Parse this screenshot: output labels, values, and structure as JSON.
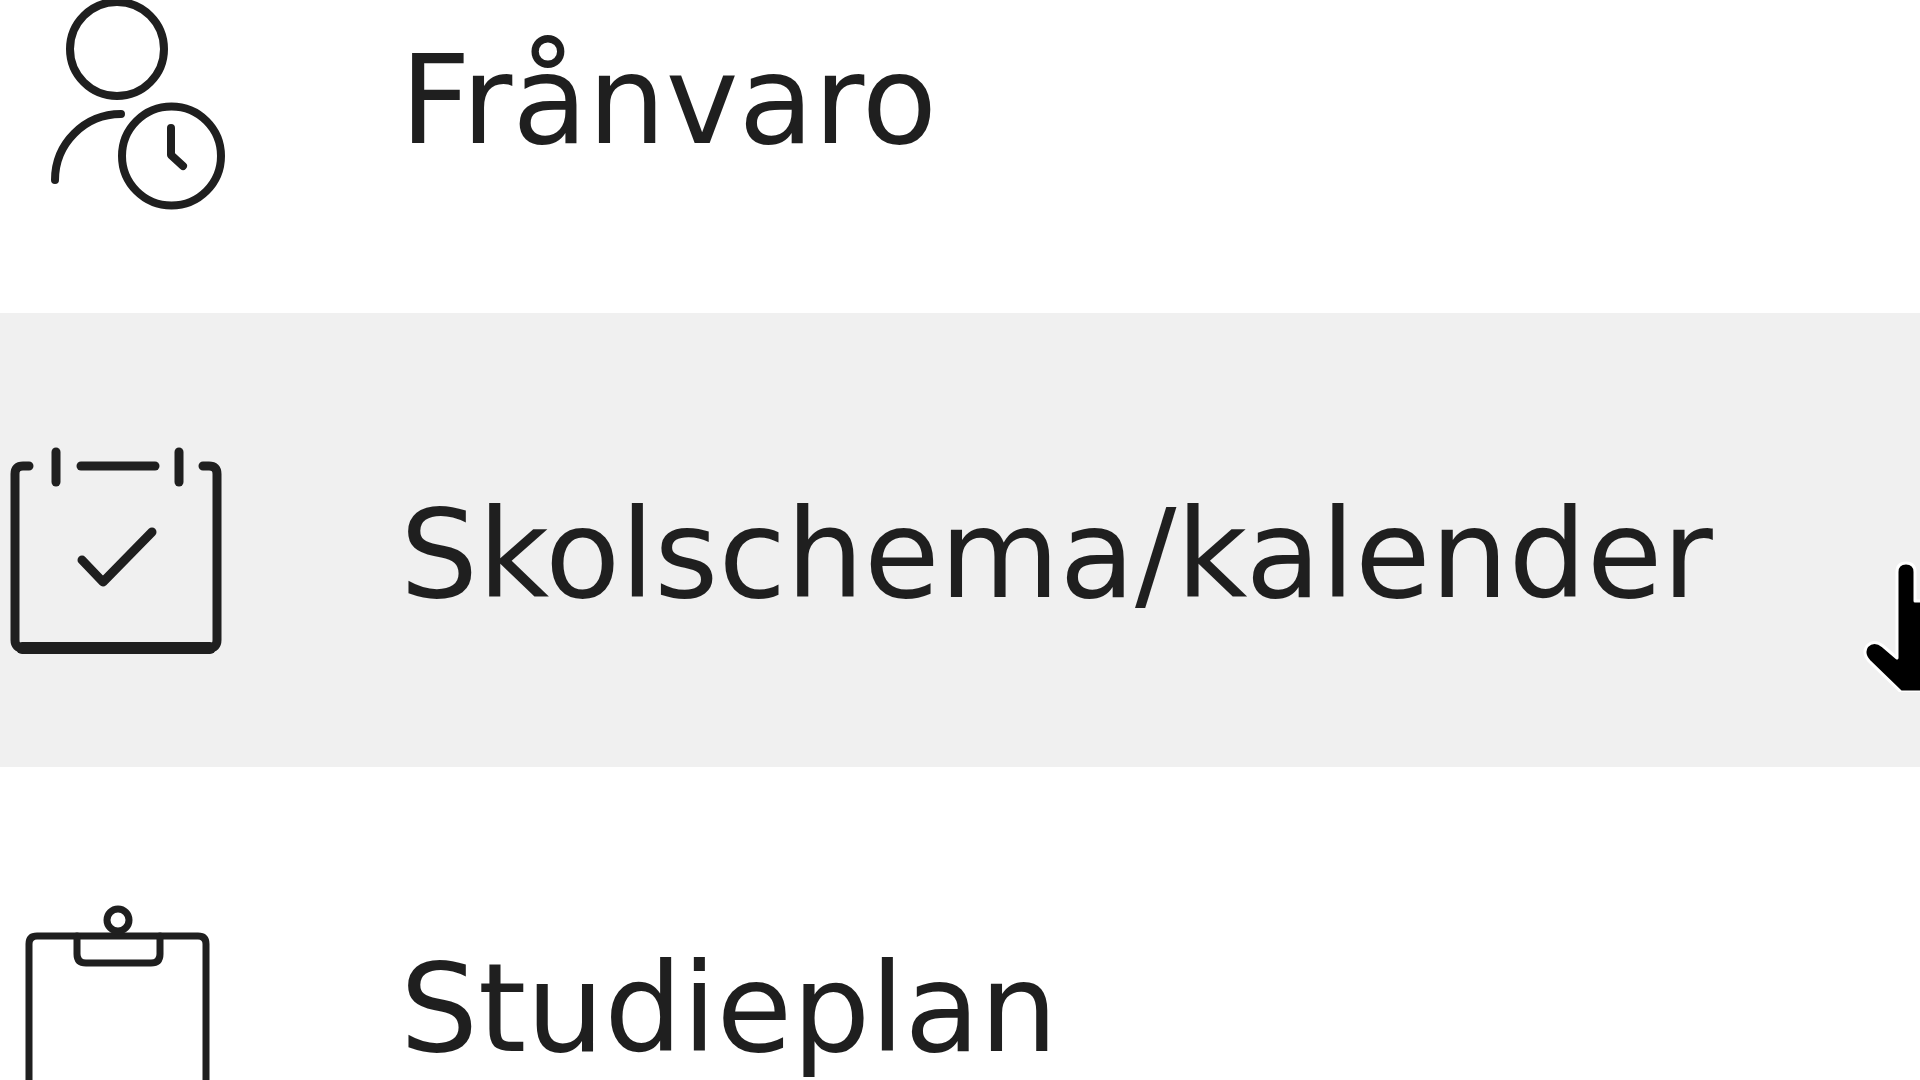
{
  "menu": {
    "items": [
      {
        "label": "Frånvaro",
        "highlighted": false
      },
      {
        "label": "Skolschema/kalender",
        "highlighted": true
      },
      {
        "label": "Studieplan",
        "highlighted": false
      }
    ]
  }
}
